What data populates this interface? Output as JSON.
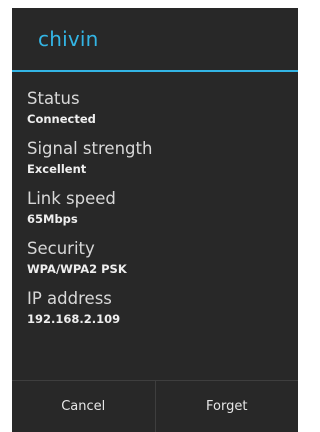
{
  "dialog": {
    "title": "chivin",
    "details": [
      {
        "label": "Status",
        "value": "Connected"
      },
      {
        "label": "Signal strength",
        "value": "Excellent"
      },
      {
        "label": "Link speed",
        "value": "65Mbps"
      },
      {
        "label": "Security",
        "value": "WPA/WPA2 PSK"
      },
      {
        "label": "IP address",
        "value": "192.168.2.109"
      }
    ],
    "buttons": {
      "cancel": "Cancel",
      "forget": "Forget"
    }
  },
  "colors": {
    "accent": "#33b5e5",
    "background": "#282828"
  }
}
